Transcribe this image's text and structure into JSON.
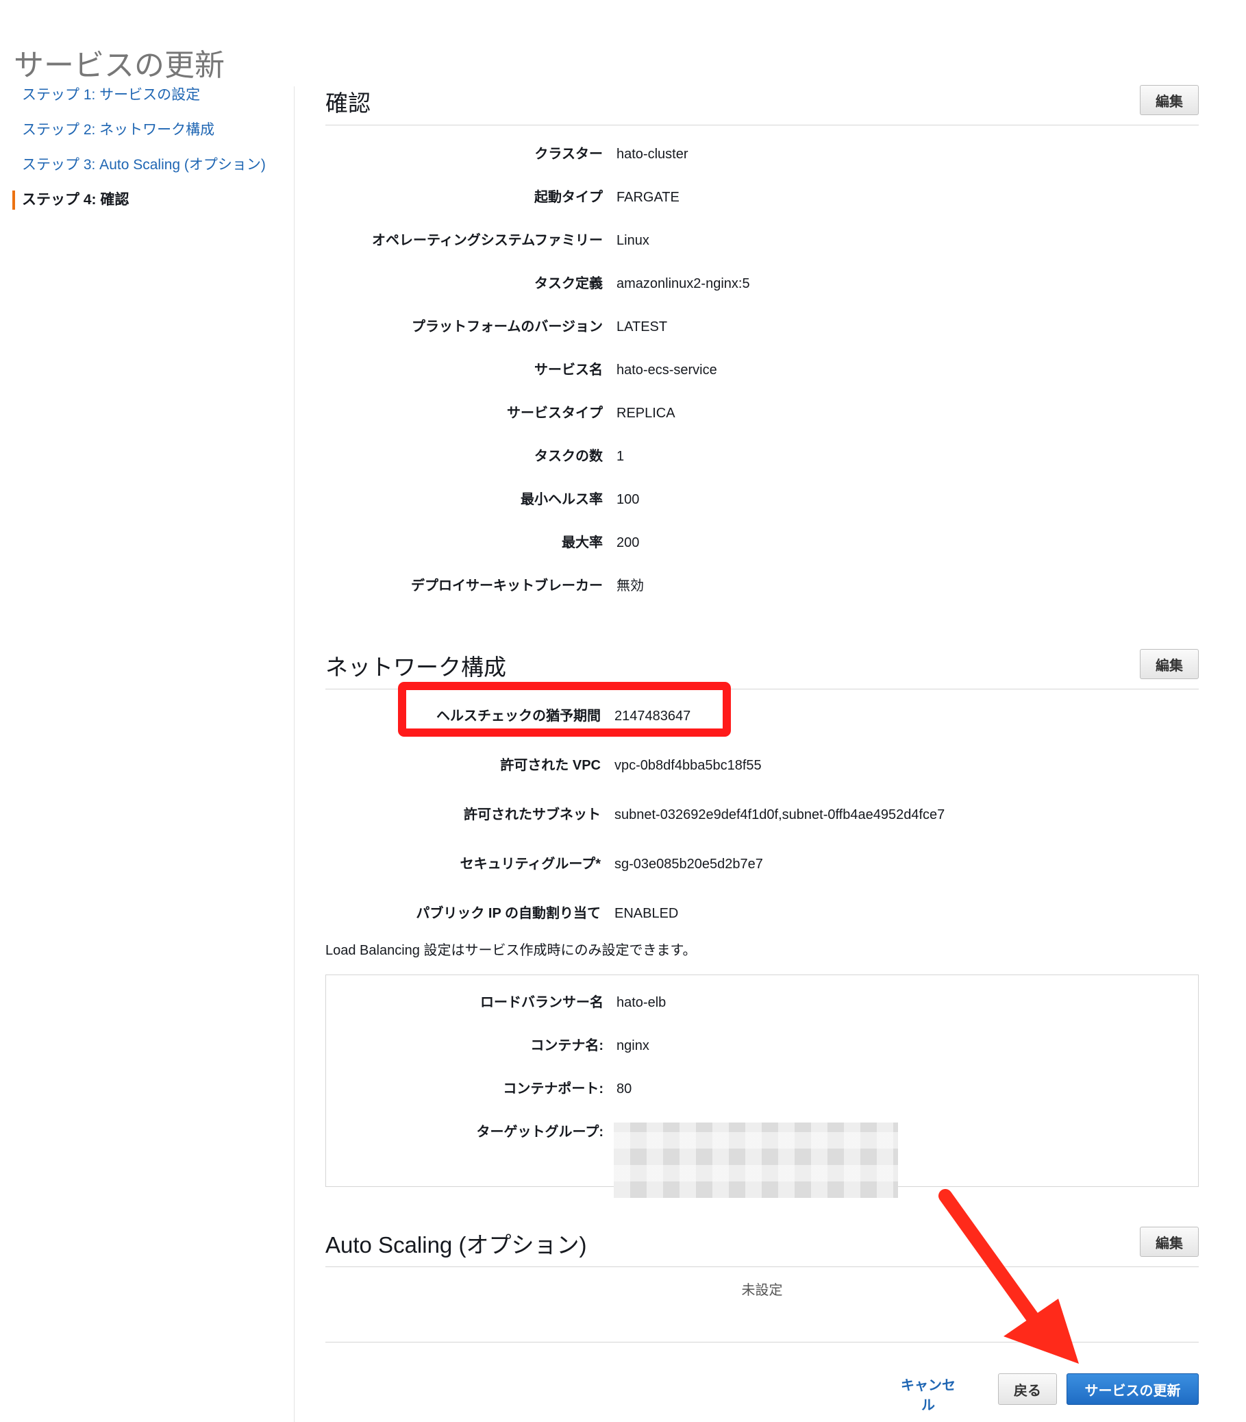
{
  "page_title": "サービスの更新",
  "steps": [
    {
      "label": "ステップ 1: サービスの設定",
      "active": false
    },
    {
      "label": "ステップ 2: ネットワーク構成",
      "active": false
    },
    {
      "label": "ステップ 3: Auto Scaling (オプション)",
      "active": false
    },
    {
      "label": "ステップ 4: 確認",
      "active": true
    }
  ],
  "edit_label": "編集",
  "review": {
    "title": "確認",
    "rows": [
      {
        "key": "クラスター",
        "value": "hato-cluster"
      },
      {
        "key": "起動タイプ",
        "value": "FARGATE"
      },
      {
        "key": "オペレーティングシステムファミリー",
        "value": "Linux"
      },
      {
        "key": "タスク定義",
        "value": "amazonlinux2-nginx:5"
      },
      {
        "key": "プラットフォームのバージョン",
        "value": "LATEST"
      },
      {
        "key": "サービス名",
        "value": "hato-ecs-service"
      },
      {
        "key": "サービスタイプ",
        "value": "REPLICA"
      },
      {
        "key": "タスクの数",
        "value": "1"
      },
      {
        "key": "最小ヘルス率",
        "value": "100"
      },
      {
        "key": "最大率",
        "value": "200"
      },
      {
        "key": "デプロイサーキットブレーカー",
        "value": "無効"
      }
    ]
  },
  "network": {
    "title": "ネットワーク構成",
    "rows": [
      {
        "key": "ヘルスチェックの猶予期間",
        "value": "2147483647"
      },
      {
        "key": "許可された VPC",
        "value": "vpc-0b8df4bba5bc18f55"
      },
      {
        "key": "許可されたサブネット",
        "value": "subnet-032692e9def4f1d0f,subnet-0ffb4ae4952d4fce7"
      },
      {
        "key": "セキュリティグループ*",
        "value": "sg-03e085b20e5d2b7e7"
      },
      {
        "key": "パブリック IP の自動割り当て",
        "value": "ENABLED"
      }
    ],
    "note": "Load Balancing 設定はサービス作成時にのみ設定できます。"
  },
  "load_balancer": {
    "rows": [
      {
        "key": "ロードバランサー名",
        "value": "hato-elb"
      },
      {
        "key": "コンテナ名:",
        "value": "nginx"
      },
      {
        "key": "コンテナポート:",
        "value": "80"
      },
      {
        "key": "ターゲットグループ:",
        "value": ""
      }
    ]
  },
  "autoscaling": {
    "title": "Auto Scaling (オプション)",
    "empty_text": "未設定"
  },
  "footer": {
    "cancel": "キャンセル",
    "back": "戻る",
    "submit": "サービスの更新"
  },
  "colors": {
    "link": "#1f66b3",
    "primary": "#1f6cc4",
    "highlight": "#ff1a1a",
    "active_step": "#ec7211"
  }
}
